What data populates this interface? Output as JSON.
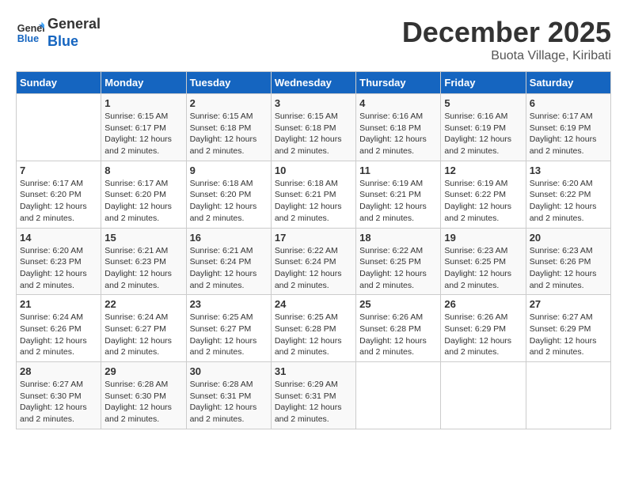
{
  "header": {
    "logo_line1": "General",
    "logo_line2": "Blue",
    "month": "December 2025",
    "location": "Buota Village, Kiribati"
  },
  "weekdays": [
    "Sunday",
    "Monday",
    "Tuesday",
    "Wednesday",
    "Thursday",
    "Friday",
    "Saturday"
  ],
  "weeks": [
    [
      {
        "day": "",
        "info": ""
      },
      {
        "day": "1",
        "info": "Sunrise: 6:15 AM\nSunset: 6:17 PM\nDaylight: 12 hours and 2 minutes."
      },
      {
        "day": "2",
        "info": "Sunrise: 6:15 AM\nSunset: 6:18 PM\nDaylight: 12 hours and 2 minutes."
      },
      {
        "day": "3",
        "info": "Sunrise: 6:15 AM\nSunset: 6:18 PM\nDaylight: 12 hours and 2 minutes."
      },
      {
        "day": "4",
        "info": "Sunrise: 6:16 AM\nSunset: 6:18 PM\nDaylight: 12 hours and 2 minutes."
      },
      {
        "day": "5",
        "info": "Sunrise: 6:16 AM\nSunset: 6:19 PM\nDaylight: 12 hours and 2 minutes."
      },
      {
        "day": "6",
        "info": "Sunrise: 6:17 AM\nSunset: 6:19 PM\nDaylight: 12 hours and 2 minutes."
      }
    ],
    [
      {
        "day": "7",
        "info": "Sunrise: 6:17 AM\nSunset: 6:20 PM\nDaylight: 12 hours and 2 minutes."
      },
      {
        "day": "8",
        "info": "Sunrise: 6:17 AM\nSunset: 6:20 PM\nDaylight: 12 hours and 2 minutes."
      },
      {
        "day": "9",
        "info": "Sunrise: 6:18 AM\nSunset: 6:20 PM\nDaylight: 12 hours and 2 minutes."
      },
      {
        "day": "10",
        "info": "Sunrise: 6:18 AM\nSunset: 6:21 PM\nDaylight: 12 hours and 2 minutes."
      },
      {
        "day": "11",
        "info": "Sunrise: 6:19 AM\nSunset: 6:21 PM\nDaylight: 12 hours and 2 minutes."
      },
      {
        "day": "12",
        "info": "Sunrise: 6:19 AM\nSunset: 6:22 PM\nDaylight: 12 hours and 2 minutes."
      },
      {
        "day": "13",
        "info": "Sunrise: 6:20 AM\nSunset: 6:22 PM\nDaylight: 12 hours and 2 minutes."
      }
    ],
    [
      {
        "day": "14",
        "info": "Sunrise: 6:20 AM\nSunset: 6:23 PM\nDaylight: 12 hours and 2 minutes."
      },
      {
        "day": "15",
        "info": "Sunrise: 6:21 AM\nSunset: 6:23 PM\nDaylight: 12 hours and 2 minutes."
      },
      {
        "day": "16",
        "info": "Sunrise: 6:21 AM\nSunset: 6:24 PM\nDaylight: 12 hours and 2 minutes."
      },
      {
        "day": "17",
        "info": "Sunrise: 6:22 AM\nSunset: 6:24 PM\nDaylight: 12 hours and 2 minutes."
      },
      {
        "day": "18",
        "info": "Sunrise: 6:22 AM\nSunset: 6:25 PM\nDaylight: 12 hours and 2 minutes."
      },
      {
        "day": "19",
        "info": "Sunrise: 6:23 AM\nSunset: 6:25 PM\nDaylight: 12 hours and 2 minutes."
      },
      {
        "day": "20",
        "info": "Sunrise: 6:23 AM\nSunset: 6:26 PM\nDaylight: 12 hours and 2 minutes."
      }
    ],
    [
      {
        "day": "21",
        "info": "Sunrise: 6:24 AM\nSunset: 6:26 PM\nDaylight: 12 hours and 2 minutes."
      },
      {
        "day": "22",
        "info": "Sunrise: 6:24 AM\nSunset: 6:27 PM\nDaylight: 12 hours and 2 minutes."
      },
      {
        "day": "23",
        "info": "Sunrise: 6:25 AM\nSunset: 6:27 PM\nDaylight: 12 hours and 2 minutes."
      },
      {
        "day": "24",
        "info": "Sunrise: 6:25 AM\nSunset: 6:28 PM\nDaylight: 12 hours and 2 minutes."
      },
      {
        "day": "25",
        "info": "Sunrise: 6:26 AM\nSunset: 6:28 PM\nDaylight: 12 hours and 2 minutes."
      },
      {
        "day": "26",
        "info": "Sunrise: 6:26 AM\nSunset: 6:29 PM\nDaylight: 12 hours and 2 minutes."
      },
      {
        "day": "27",
        "info": "Sunrise: 6:27 AM\nSunset: 6:29 PM\nDaylight: 12 hours and 2 minutes."
      }
    ],
    [
      {
        "day": "28",
        "info": "Sunrise: 6:27 AM\nSunset: 6:30 PM\nDaylight: 12 hours and 2 minutes."
      },
      {
        "day": "29",
        "info": "Sunrise: 6:28 AM\nSunset: 6:30 PM\nDaylight: 12 hours and 2 minutes."
      },
      {
        "day": "30",
        "info": "Sunrise: 6:28 AM\nSunset: 6:31 PM\nDaylight: 12 hours and 2 minutes."
      },
      {
        "day": "31",
        "info": "Sunrise: 6:29 AM\nSunset: 6:31 PM\nDaylight: 12 hours and 2 minutes."
      },
      {
        "day": "",
        "info": ""
      },
      {
        "day": "",
        "info": ""
      },
      {
        "day": "",
        "info": ""
      }
    ]
  ]
}
